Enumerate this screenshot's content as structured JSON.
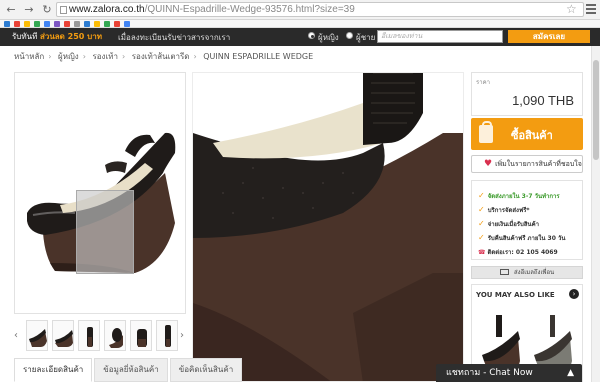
{
  "browser": {
    "url_host": "www.zalora.co.th",
    "url_path": "/QUINN-Espadrille-Wedge-93576.html?size=39"
  },
  "header": {
    "notice_prefix": "รับทันที",
    "notice_highlight": "ส่วนลด 250 บาท",
    "newsletter_text": "เมื่อลงทะเบียนรับข่าวสารจากเรา",
    "radio_women": "ผู้หญิง",
    "radio_men": "ผู้ชาย",
    "email_placeholder": "อีเมลของท่าน",
    "subscribe_label": "สมัครเลย"
  },
  "breadcrumb": [
    "หน้าหลัก",
    "ผู้หญิง",
    "รองเท้า",
    "รองเท้าส้นเตารีด",
    "QUINN ESPADRILLE WEDGE"
  ],
  "product": {
    "price_label": "ราคา",
    "price": "1,090 THB",
    "buy_label": "ซื้อสินค้า",
    "wishlist_label": "เพิ่มในรายการสินค้าที่ชอบใจ",
    "services": {
      "delivery_prefix": "จัดส่งภายใน",
      "delivery_days": "3-7 วันทำการ",
      "free_shipping": "บริการจัดส่งฟรี*",
      "cod": "จ่ายเงินเมื่อรับสินค้า",
      "returns": "รับคืนสินค้าฟรี ภายใน 30 วัน",
      "hotline": "ติดต่อเรา: 02 105 4069"
    },
    "send_friend_label": "ส่งอีเมลถึงเพื่อน",
    "may_also_like": "YOU MAY ALSO LIKE"
  },
  "tabs": [
    "รายละเอียดสินค้า",
    "ข้อมูลยี่ห้อสินค้า",
    "ข้อคิดเห็นสินค้า"
  ],
  "chat": {
    "label": "แชทถาม - Chat Now"
  },
  "colors": {
    "accent": "#f39c11",
    "header_bg": "#2a2a2a",
    "shoe_brown": "#4a3329"
  }
}
